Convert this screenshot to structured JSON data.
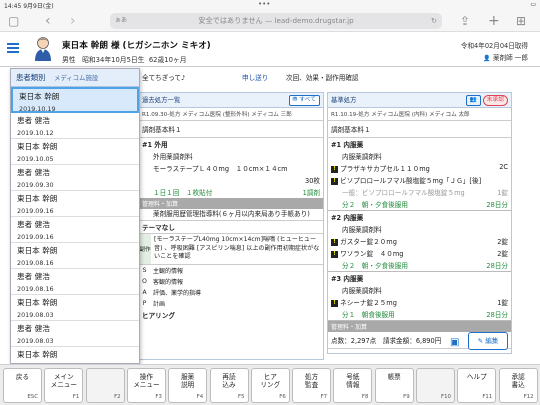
{
  "status": {
    "time": "14:45",
    "date": "9月9日(金)",
    "dots": "•••"
  },
  "browser": {
    "aa": "ぁあ",
    "url": "安全ではありません — lead-demo.drugstar.jp"
  },
  "patient": {
    "name": "東日本 幹朗 様 (ヒガシニホン ミキオ)",
    "gender": "男性",
    "birth": "昭和34年10月5日生",
    "age": "62歳10ヶ月",
    "retrieved": "令和4年02月04日取得",
    "user": "薬剤師 一郎"
  },
  "toolbar": {
    "message": "全てちぎって♪",
    "send": "申し送り",
    "next": "次回、効果・副作用確認"
  },
  "dropdown": {
    "title": "患者類別",
    "subtitle": "メディコム施設",
    "items": [
      {
        "name": "東日本 幹朗",
        "date": "2019.10.19",
        "selected": true
      },
      {
        "name": "患者 健浩",
        "date": "2019.10.12"
      },
      {
        "name": "東日本 幹朗",
        "date": "2019.10.05"
      },
      {
        "name": "患者 健浩",
        "date": "2019.09.30"
      },
      {
        "name": "東日本 幹朗",
        "date": "2019.09.16"
      },
      {
        "name": "患者 健浩",
        "date": "2019.09.16"
      },
      {
        "name": "東日本 幹朗",
        "date": "2019.08.16"
      },
      {
        "name": "患者 健浩",
        "date": "2019.08.16"
      },
      {
        "name": "東日本 幹朗",
        "date": "2019.08.03"
      },
      {
        "name": "患者 健浩",
        "date": "2019.08.03"
      },
      {
        "name": "東日本 幹朗",
        "date": "2019.07.27"
      }
    ]
  },
  "mid": {
    "title": "過去処方一覧",
    "tag": "すべて",
    "sub": "R1.09.30-処方 メディコム医院 (整形外科) メディコム 三郎",
    "fee": "調剤基本料１",
    "rp": "#1 外用",
    "cat": "外用薬調剤料",
    "drug": "モーラステープＬ４０mg　１０cm×１４cm",
    "qty": "30枚",
    "usage": "１日１回　１枚貼付",
    "usage_r": "1調剤",
    "bar1": "管理料・加算",
    "kanri": "薬剤服用歴管理指導料(６ヶ月以内来局あり手帳あり)",
    "teme": "テーマなし",
    "side": "副作",
    "note": "[モーラステープL40mg 10cm×14cm]喘鳴 (ヒューヒュー音) 、呼吸困難 [アスピリン喘息] 以上の副作用初期症状がないことを確認",
    "soap": [
      {
        "k": "S",
        "v": "主観的情報"
      },
      {
        "k": "O",
        "v": "客観的情報"
      },
      {
        "k": "A",
        "v": "評価、薬学的指導"
      },
      {
        "k": "P",
        "v": "計画"
      }
    ],
    "hearing": "ヒアリング"
  },
  "right": {
    "title": "基準処方",
    "tag": "未承認",
    "sub": "R1.10.19-処方 メディコム医院 (内科) メディコム 太郎",
    "fee": "調剤基本料１",
    "rps": [
      {
        "h": "#1 内服薬",
        "cat": "内服薬調剤料",
        "drugs": [
          {
            "n": "プラザキサカプセル１１０mg",
            "q": "2C"
          },
          {
            "n": "ビソプロロールフマル酸塩錠５mg「ＪＧ」[後]",
            "q": ""
          },
          {
            "n": "一般：ビソプロロールフマル酸塩錠５mg",
            "q": "1錠",
            "grey": true
          }
        ],
        "u": "分２　朝・夕食後服用",
        "d": "28日分"
      },
      {
        "h": "#2 内服薬",
        "cat": "内服薬調剤料",
        "drugs": [
          {
            "n": "ガスター錠２０mg",
            "q": "2錠"
          },
          {
            "n": "ワソラン錠　４０mg",
            "q": "2錠"
          }
        ],
        "u": "分２　朝・夕食後服用",
        "d": "28日分"
      },
      {
        "h": "#3 内服薬",
        "cat": "内服薬調剤料",
        "drugs": [
          {
            "n": "ネシーナ錠２５mg",
            "q": "1錠"
          }
        ],
        "u": "分１　朝食後服用",
        "d": "28日分"
      }
    ],
    "bar": "管理料・加算",
    "points": "点数：2,297点　請求金額：6,890円",
    "memo": "メモ",
    "edit": "編集"
  },
  "fkeys": [
    {
      "l": "戻る",
      "k": "ESC"
    },
    {
      "l": "メイン\nメニュー",
      "k": "F1"
    },
    {
      "l": "",
      "k": "F2",
      "dis": true
    },
    {
      "l": "操作\nメニュー",
      "k": "F3"
    },
    {
      "l": "服薬\n説明",
      "k": "F4"
    },
    {
      "l": "再読\n込み",
      "k": "F5"
    },
    {
      "l": "ヒア\nリング",
      "k": "F6"
    },
    {
      "l": "処方\n監査",
      "k": "F7"
    },
    {
      "l": "号紙\n情報",
      "k": "F8"
    },
    {
      "l": "帳票",
      "k": "F9"
    },
    {
      "l": "",
      "k": "F10",
      "dis": true
    },
    {
      "l": "ヘルプ",
      "k": "F11"
    },
    {
      "l": "承認\n書込",
      "k": "F12"
    }
  ]
}
